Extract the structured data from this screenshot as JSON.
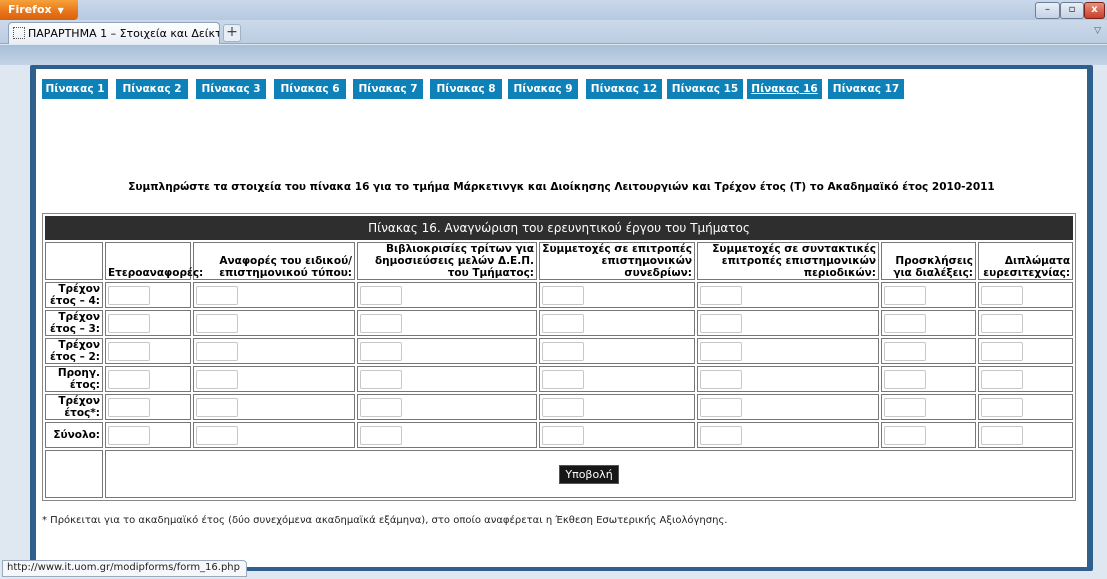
{
  "browser": {
    "menu_label": "Firefox",
    "menu_caret": "▼",
    "tab_title": "ΠΑΡΑΡΤΗΜΑ 1 – Στοιχεία και Δείκτες τ...",
    "new_tab": "+",
    "tab_list": "▽",
    "window_min": "–",
    "window_max": "▫",
    "window_close": "x"
  },
  "nav": {
    "buttons": [
      "Πίνακας 1",
      "Πίνακας 2",
      "Πίνακας 3",
      "Πίνακας 6",
      "Πίνακας 7",
      "Πίνακας 8",
      "Πίνακας 9",
      "Πίνακας 12",
      "Πίνακας 15",
      "Πίνακας 16",
      "Πίνακας 17"
    ],
    "active": "Πίνακας 16"
  },
  "instructions": "Συμπληρώστε τα στοιχεία του πίνακα 16 για το τμήμα Μάρκετινγκ και Διοίκησης Λειτουργιών και Τρέχον έτος (Τ) το Ακαδημαϊκό έτος 2010-2011",
  "table": {
    "caption": "Πίνακας 16. Αναγνώριση του ερευνητικού έργου του Τμήματος",
    "columns": [
      "Ετεροαναφορές:",
      "Αναφορές του ειδικού/επιστημονικού τύπου:",
      "Βιβλιοκρισίες τρίτων για δημοσιεύσεις μελών Δ.Ε.Π. του Τμήματος:",
      "Συμμετοχές σε επιτροπές επιστημονικών συνεδρίων:",
      "Συμμετοχές σε συντακτικές επιτροπές επιστημονικών περιοδικών:",
      "Προσκλήσεις για διαλέξεις:",
      "Διπλώματα ευρεσιτεχνίας:"
    ],
    "rows": [
      "Τρέχον έτος – 4:",
      "Τρέχον έτος – 3:",
      "Τρέχον έτος – 2:",
      "Προηγ. έτος:",
      "Τρέχον έτος*:",
      "Σύνολο:"
    ],
    "submit_label": "Υποβολή"
  },
  "footnote": "* Πρόκειται για το ακαδημαϊκό έτος (δύο συνεχόμενα ακαδημαϊκά εξάμηνα), στο οποίο αναφέρεται η Έκθεση Εσωτερικής Αξιολόγησης.",
  "status_url": "http://www.it.uom.gr/modipforms/form_16.php",
  "colors": {
    "nav_button": "#0f81b9",
    "frame": "#2f5f8d",
    "caption_bg": "#2e2e2e",
    "firefox_orange": "#e8741a"
  }
}
